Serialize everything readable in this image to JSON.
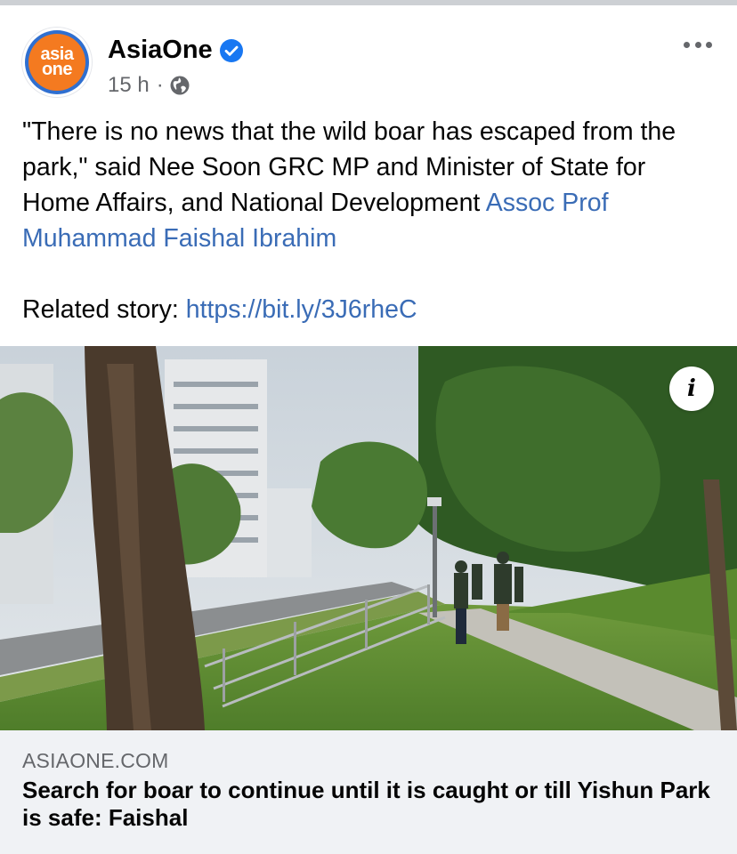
{
  "post": {
    "page_name": "AsiaOne",
    "time": "15 h",
    "separator": "·",
    "audience_icon": "globe-icon",
    "verified_icon": "verified-badge-icon",
    "avatar": {
      "line1": "asia",
      "line2": "one",
      "colors": {
        "ring": "#2f6fd0",
        "fill": "#f47a20"
      }
    },
    "text_before": "\"There is no news that the wild boar has escaped from the park,\" said Nee Soon GRC MP and Minister of State for Home Affairs, and National Development ",
    "mention": "Assoc Prof Muhammad Faishal Ibrahim",
    "related_label": "Related story: ",
    "related_link": "https://bit.ly/3J6rheC"
  },
  "link_preview": {
    "domain": "ASIAONE.COM",
    "headline": "Search for boar to continue until it is caught or till Yishun Park is safe: Faishal",
    "info_label": "i"
  },
  "colors": {
    "link": "#3a6cb6",
    "secondary_text": "#65676b",
    "card_bg": "#f0f2f5",
    "verified": "#1877f2"
  }
}
